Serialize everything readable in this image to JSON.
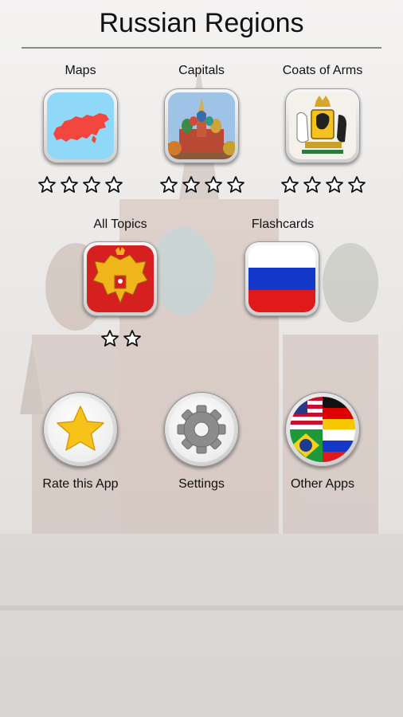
{
  "app": {
    "title": "Russian Regions"
  },
  "menu": {
    "tiles": [
      {
        "label": "Maps",
        "icon": "russia-map-icon",
        "stars": 4
      },
      {
        "label": "Capitals",
        "icon": "st-basils-cathedral-icon",
        "stars": 4
      },
      {
        "label": "Coats of Arms",
        "icon": "yaroslavl-coat-of-arms-icon",
        "stars": 4
      },
      {
        "label": "All Topics",
        "icon": "russian-coat-of-arms-icon",
        "stars": 2
      },
      {
        "label": "Flashcards",
        "icon": "russian-flag-icon",
        "stars": 0
      }
    ],
    "actions": [
      {
        "label": "Rate this App",
        "icon": "star-icon"
      },
      {
        "label": "Settings",
        "icon": "gear-icon"
      },
      {
        "label": "Other Apps",
        "icon": "flags-icon"
      }
    ]
  },
  "colors": {
    "map_sea": "#8fd8f7",
    "map_land": "#f2463e",
    "flag_white": "#ffffff",
    "flag_blue": "#1438c8",
    "flag_red": "#e01a1a",
    "star_gold": "#f7c31a"
  }
}
